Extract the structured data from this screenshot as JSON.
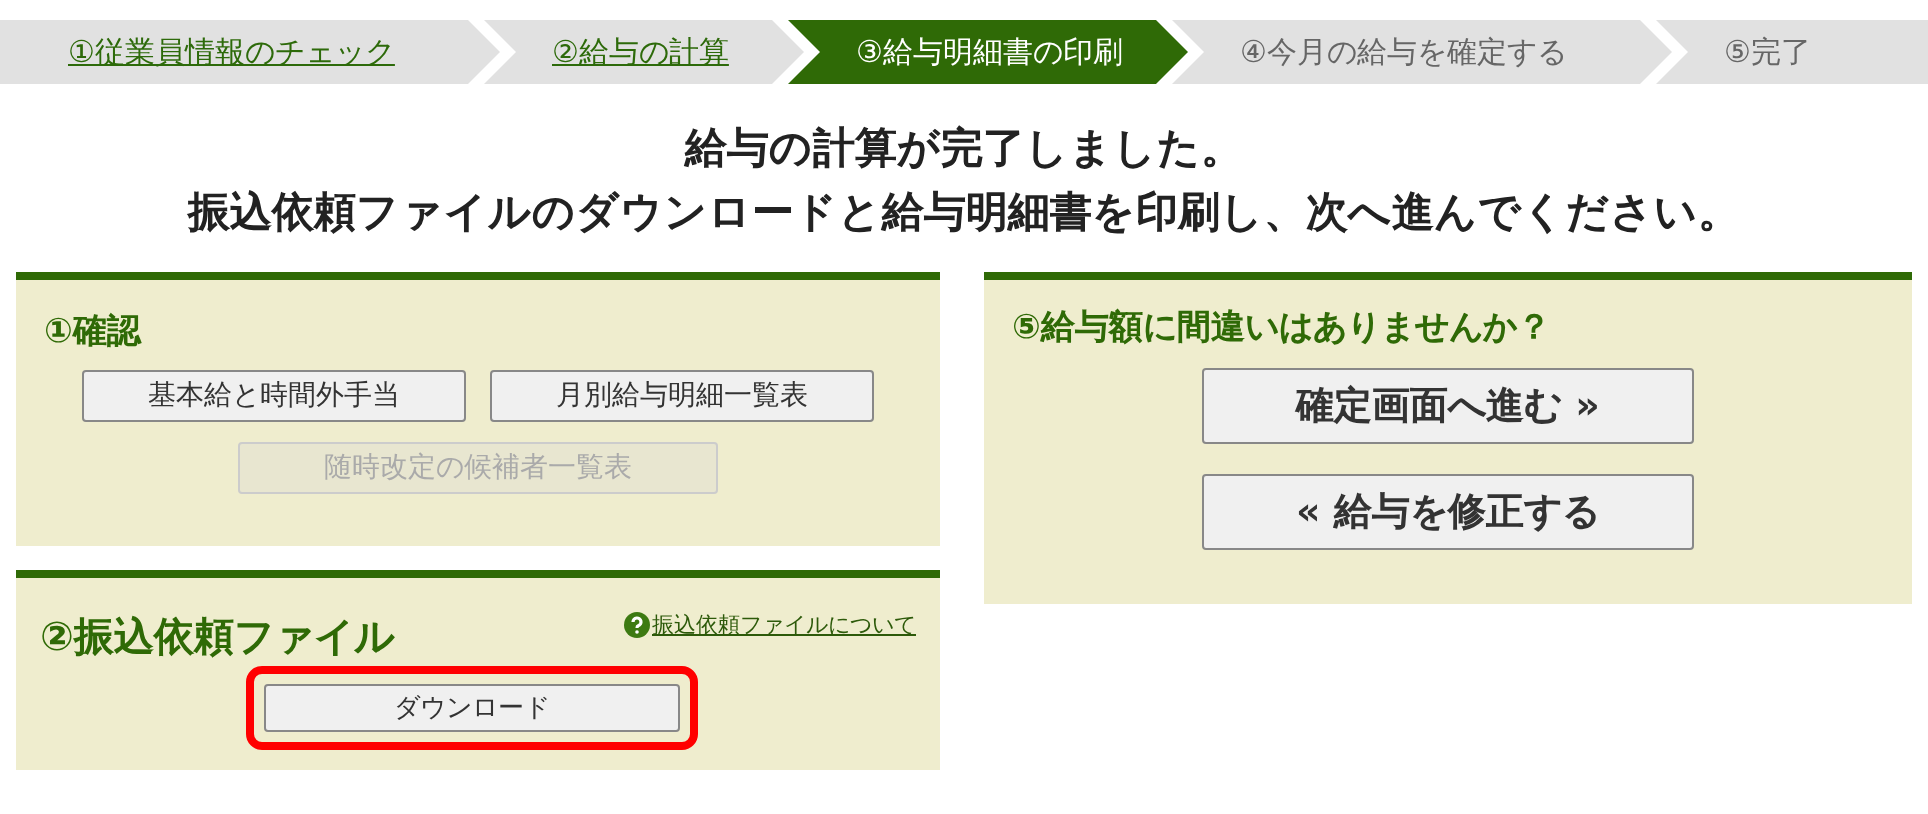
{
  "steps": [
    {
      "label": "①従業員情報のチェック",
      "selected": false,
      "done": true
    },
    {
      "label": "②給与の計算",
      "selected": false,
      "done": true
    },
    {
      "label": "③給与明細書の印刷",
      "selected": true,
      "done": false
    },
    {
      "label": "④今月の給与を確定する",
      "selected": false,
      "done": false
    },
    {
      "label": "⑤完了",
      "selected": false,
      "done": false
    }
  ],
  "headline": [
    "給与の計算が完了しました。",
    "振込依頼ファイルのダウンロードと給与明細書を印刷し、次へ進んでください。"
  ],
  "confirm_panel": {
    "title": "①確認",
    "buttons": [
      {
        "label": "基本給と時間外手当",
        "disabled": false
      },
      {
        "label": "月別給与明細一覧表",
        "disabled": false
      },
      {
        "label": "随時改定の候補者一覧表",
        "disabled": true
      }
    ]
  },
  "file_panel": {
    "title": "②振込依頼ファイル",
    "help_link": "振込依頼ファイルについて",
    "button": {
      "label": "ダウンロード",
      "highlighted": true
    }
  },
  "decision_panel": {
    "title": "⑤給与額に間違いはありませんか？",
    "buttons": [
      {
        "label": "確定画面へ進む »"
      },
      {
        "label": "« 給与を修正する"
      }
    ]
  }
}
